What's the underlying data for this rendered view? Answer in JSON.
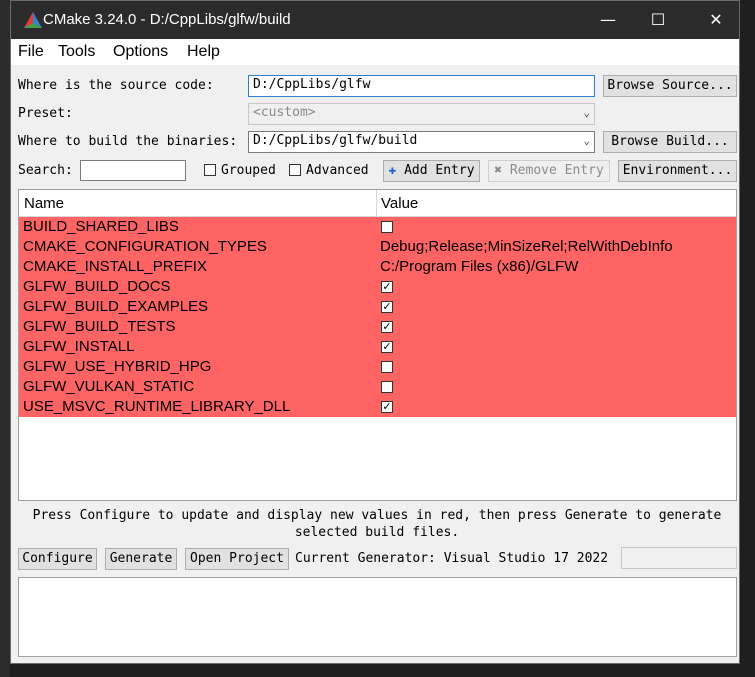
{
  "window": {
    "title": "CMake 3.24.0 - D:/CppLibs/glfw/build",
    "minimize_glyph": "—",
    "maximize_glyph": "☐",
    "close_glyph": "✕"
  },
  "menu": [
    {
      "label": "File"
    },
    {
      "label": "Tools"
    },
    {
      "label": "Options"
    },
    {
      "label": "Help"
    }
  ],
  "source": {
    "label": "Where is the source code:",
    "value": "D:/CppLibs/glfw",
    "browse_label": "Browse Source..."
  },
  "preset": {
    "label": "Preset:",
    "value": "<custom>"
  },
  "build": {
    "label": "Where to build the binaries:",
    "value": "D:/CppLibs/glfw/build",
    "browse_label": "Browse Build..."
  },
  "search": {
    "label": "Search:",
    "value": "",
    "grouped_label": "Grouped",
    "grouped_checked": false,
    "advanced_label": "Advanced",
    "advanced_checked": false,
    "add_entry_label": "Add Entry",
    "remove_entry_label": "Remove Entry",
    "environment_label": "Environment..."
  },
  "table": {
    "columns": [
      "Name",
      "Value"
    ],
    "rows": [
      {
        "name": "BUILD_SHARED_LIBS",
        "type": "bool",
        "checked": false
      },
      {
        "name": "CMAKE_CONFIGURATION_TYPES",
        "type": "text",
        "value": "Debug;Release;MinSizeRel;RelWithDebInfo"
      },
      {
        "name": "CMAKE_INSTALL_PREFIX",
        "type": "text",
        "value": "C:/Program Files (x86)/GLFW"
      },
      {
        "name": "GLFW_BUILD_DOCS",
        "type": "bool",
        "checked": true
      },
      {
        "name": "GLFW_BUILD_EXAMPLES",
        "type": "bool",
        "checked": true
      },
      {
        "name": "GLFW_BUILD_TESTS",
        "type": "bool",
        "checked": true
      },
      {
        "name": "GLFW_INSTALL",
        "type": "bool",
        "checked": true
      },
      {
        "name": "GLFW_USE_HYBRID_HPG",
        "type": "bool",
        "checked": false
      },
      {
        "name": "GLFW_VULKAN_STATIC",
        "type": "bool",
        "checked": false
      },
      {
        "name": "USE_MSVC_RUNTIME_LIBRARY_DLL",
        "type": "bool",
        "checked": true
      }
    ],
    "row_color": "#ff6464"
  },
  "hint": {
    "line1": "Press Configure to update and display new values in red, then press Generate to generate",
    "line2": "selected build files."
  },
  "actions": {
    "configure_label": "Configure",
    "generate_label": "Generate",
    "open_project_label": "Open Project",
    "generator_text": "Current Generator: Visual Studio 17 2022"
  },
  "icons": {
    "app": "cmake-triangle-icon",
    "add": "plus-icon",
    "remove": "x-icon",
    "check_glyph": "✓"
  }
}
